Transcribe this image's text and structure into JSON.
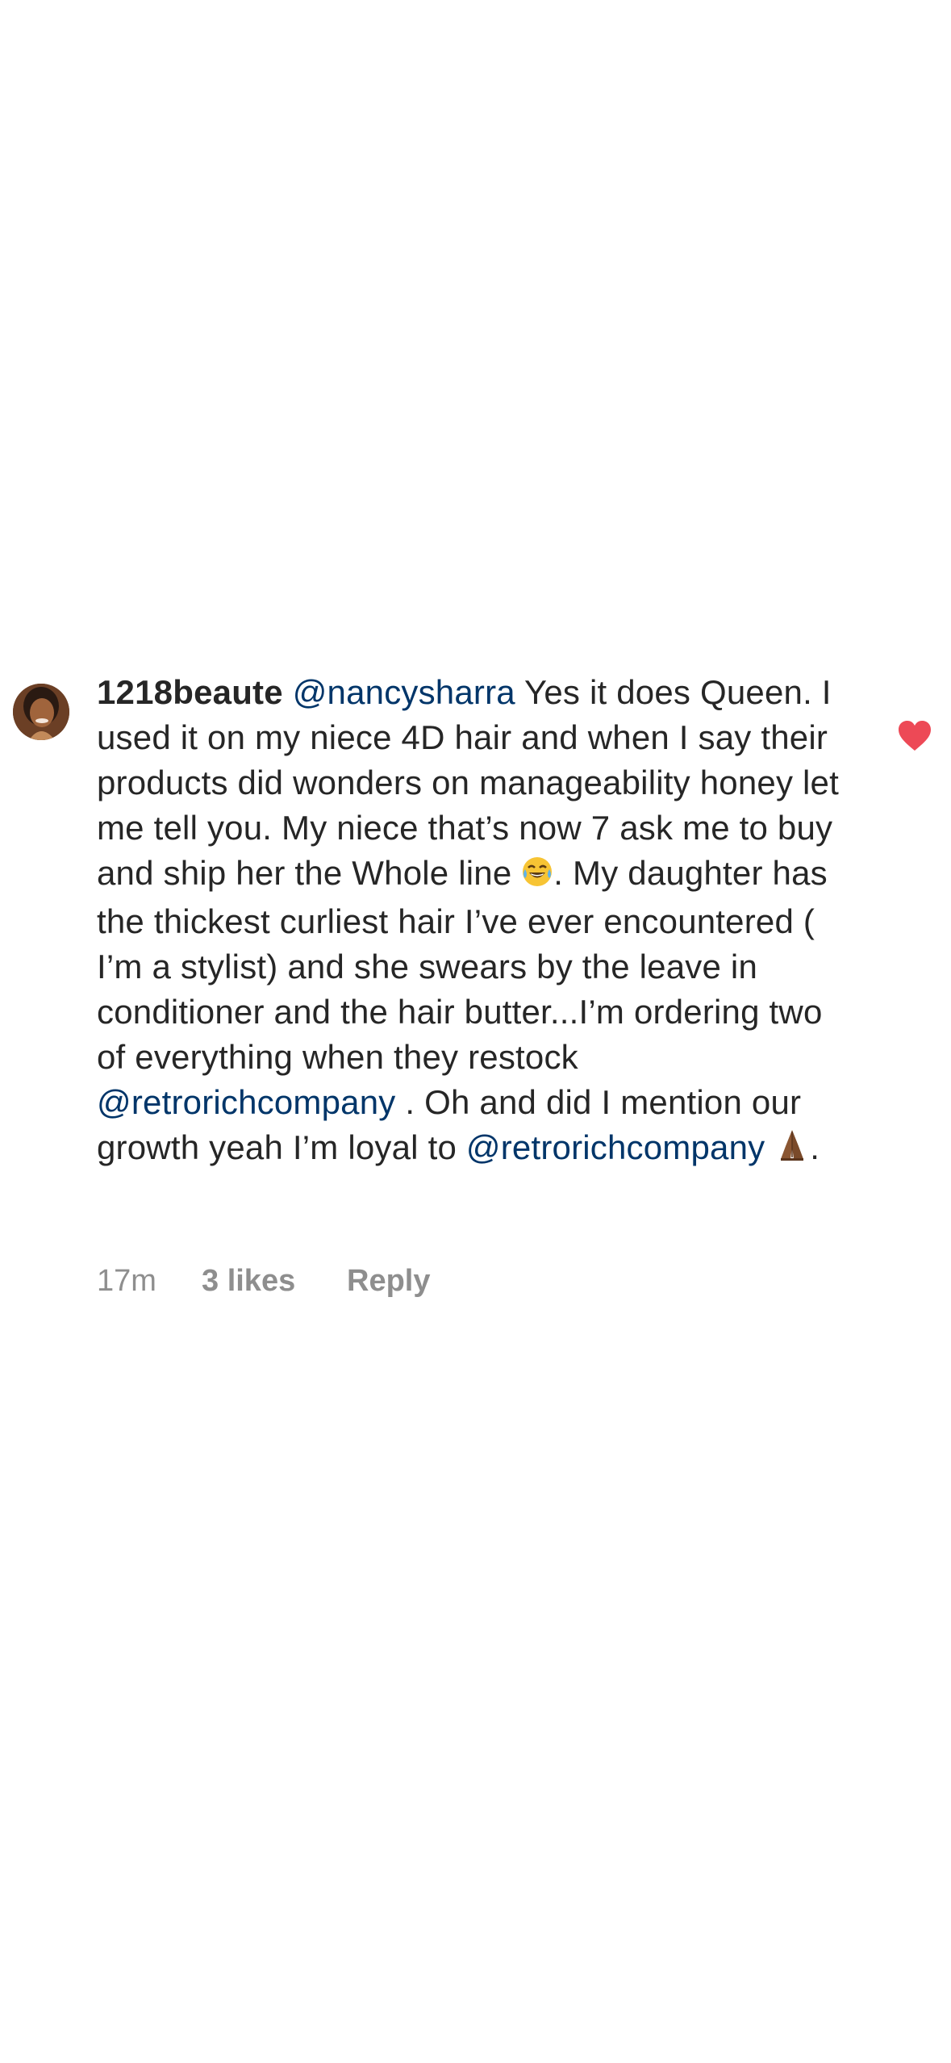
{
  "comment": {
    "username": "1218beaute",
    "segments": [
      {
        "type": "mention",
        "text": "@nancysharra"
      },
      {
        "type": "text",
        "text": " Yes it does Queen. I used it on my niece 4D hair and when I say their products did wonders on manageability honey let me tell you. My niece that’s now 7 ask me to buy and ship her the Whole line "
      },
      {
        "type": "emoji",
        "icon": "tears-of-joy-emoji"
      },
      {
        "type": "text",
        "text": ". My daughter has the thickest curliest hair I’ve ever encountered ( I’m a stylist) and she swears by the leave in conditioner and the hair butter...I’m ordering two of everything when they restock "
      },
      {
        "type": "mention",
        "text": "@retrorichcompany"
      },
      {
        "type": "text",
        "text": " . Oh and did I mention our growth yeah I’m loyal to "
      },
      {
        "type": "mention",
        "text": "@retrorichcompany"
      },
      {
        "type": "text",
        "text": " "
      },
      {
        "type": "emoji",
        "icon": "folded-hands-emoji"
      },
      {
        "type": "text",
        "text": "."
      }
    ],
    "time": "17m",
    "likes": "3 likes",
    "reply_label": "Reply",
    "liked": true
  },
  "colors": {
    "mention": "#003569",
    "heart": "#ed4956",
    "meta": "#8e8e8e",
    "text": "#262626"
  }
}
